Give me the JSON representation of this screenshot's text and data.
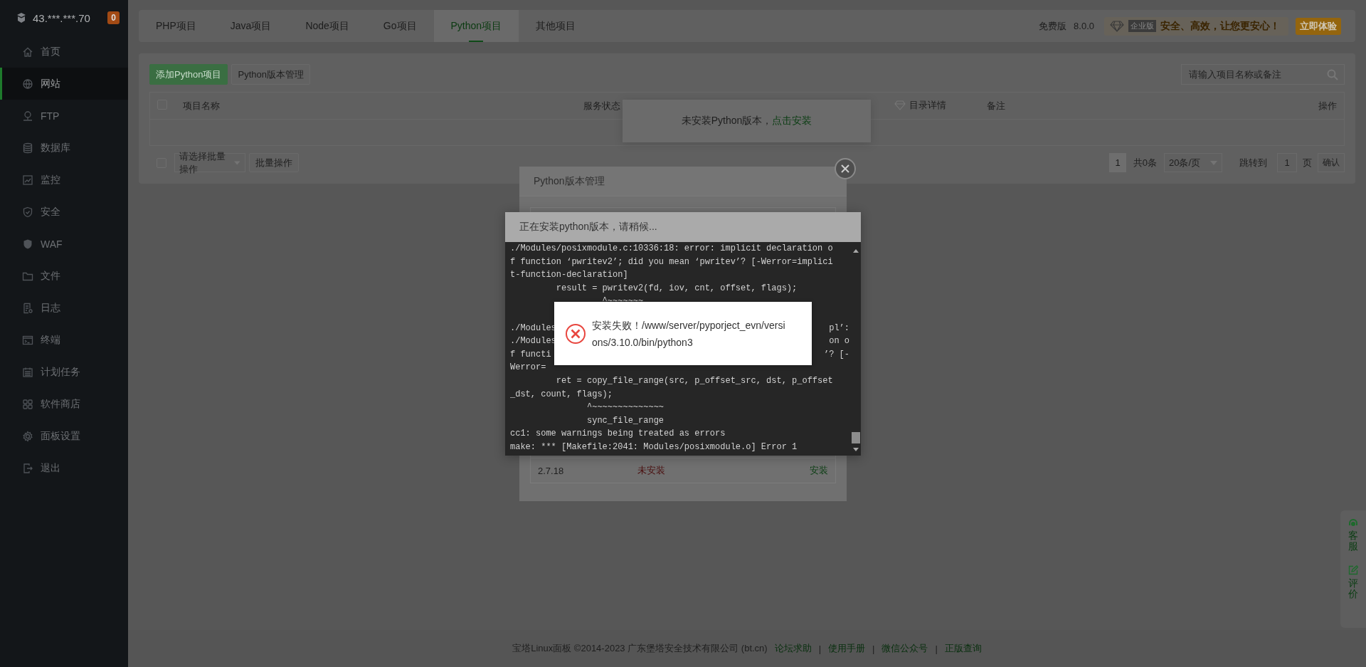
{
  "sidebar": {
    "host": "43.***.***.70",
    "badge": "0",
    "items": [
      {
        "label": "首页",
        "selected": false
      },
      {
        "label": "网站",
        "selected": true
      },
      {
        "label": "FTP",
        "selected": false
      },
      {
        "label": "数据库",
        "selected": false
      },
      {
        "label": "监控",
        "selected": false
      },
      {
        "label": "安全",
        "selected": false
      },
      {
        "label": "WAF",
        "selected": false
      },
      {
        "label": "文件",
        "selected": false
      },
      {
        "label": "日志",
        "selected": false
      },
      {
        "label": "终端",
        "selected": false
      },
      {
        "label": "计划任务",
        "selected": false
      },
      {
        "label": "软件商店",
        "selected": false
      },
      {
        "label": "面板设置",
        "selected": false
      },
      {
        "label": "退出",
        "selected": false
      }
    ]
  },
  "tabs": [
    {
      "label": "PHP项目",
      "selected": false
    },
    {
      "label": "Java项目",
      "selected": false
    },
    {
      "label": "Node项目",
      "selected": false
    },
    {
      "label": "Go项目",
      "selected": false
    },
    {
      "label": "Python项目",
      "selected": true
    },
    {
      "label": "其他项目",
      "selected": false
    }
  ],
  "edition": {
    "label": "免费版",
    "version": "8.0.0",
    "promo_tag": "企业版",
    "promo_text": "安全、高效，让您更安心！",
    "button": "立即体验"
  },
  "toolbar": {
    "buttons": [
      {
        "label": "添加Python项目",
        "kind": "primary"
      },
      {
        "label": "Python版本管理",
        "kind": "default"
      }
    ],
    "search": {
      "placeholder": "请输入项目名称或备注"
    }
  },
  "table": {
    "select_all": {
      "checked": false
    },
    "columns": [
      "项目名称",
      "服务状态",
      "目录详情",
      "备注",
      "操作"
    ]
  },
  "bulk": {
    "checked": false,
    "select": "请选择批量操作",
    "button": "批量操作"
  },
  "pagination": {
    "current": "1",
    "total": "共0条",
    "page_size": "20条/页",
    "goto_label": "跳转到",
    "goto_value": "1",
    "page_unit": "页",
    "confirm": "确认"
  },
  "tooltip": {
    "text": "未安装Python版本，",
    "link": "点击安装"
  },
  "version_modal": {
    "title": "Python版本管理",
    "versions": [
      {
        "version": "2.7.18",
        "status": "未安装",
        "installed": false,
        "action": "安装"
      }
    ]
  },
  "install_dialog": {
    "title": "正在安装python版本，请稍候...",
    "lines": [
      {
        "kind": "full",
        "text": "./Modules/posixmodule.c:10336:18: error: implicit declaration o"
      },
      {
        "kind": "full",
        "text": "f function ‘pwritev2’; did you mean ‘pwritev’? [-Werror=implici"
      },
      {
        "kind": "full",
        "text": "t-function-declaration]"
      },
      {
        "kind": "full",
        "text": "         result = pwritev2(fd, iov, cnt, offset, flags);"
      },
      {
        "kind": "full",
        "text": "                  ^~~~~~~~"
      },
      {
        "kind": "blank"
      },
      {
        "kind": "split",
        "left": "./Modules",
        "right": "pl’:"
      },
      {
        "kind": "split",
        "left": "./Modules",
        "right": "on o"
      },
      {
        "kind": "split",
        "left": "f functi",
        "right": "’? [-"
      },
      {
        "kind": "split",
        "left": "Werror="
      },
      {
        "kind": "full",
        "text": "         ret = copy_file_range(src, p_offset_src, dst, p_offset"
      },
      {
        "kind": "full",
        "text": "_dst, count, flags);"
      },
      {
        "kind": "full",
        "text": "               ^~~~~~~~~~~~~~~"
      },
      {
        "kind": "full",
        "text": "               sync_file_range"
      },
      {
        "kind": "full",
        "text": "cc1: some warnings being treated as errors"
      },
      {
        "kind": "full",
        "text": "make: *** [Makefile:2041: Modules/posixmodule.o] Error 1"
      }
    ]
  },
  "error_message": {
    "text": "安装失败！/www/server/pyporject_evn/versions/3.10.0/bin/python3"
  },
  "footer": {
    "copyright": "宝塔Linux面板 ©2014-2023 广东堡塔安全技术有限公司 (bt.cn)",
    "links": [
      "论坛求助",
      "使用手册",
      "微信公众号",
      "正版查询"
    ],
    "separators": [
      "|",
      "|",
      "|"
    ]
  },
  "float_panel": {
    "items": [
      "客服",
      "评价"
    ]
  }
}
